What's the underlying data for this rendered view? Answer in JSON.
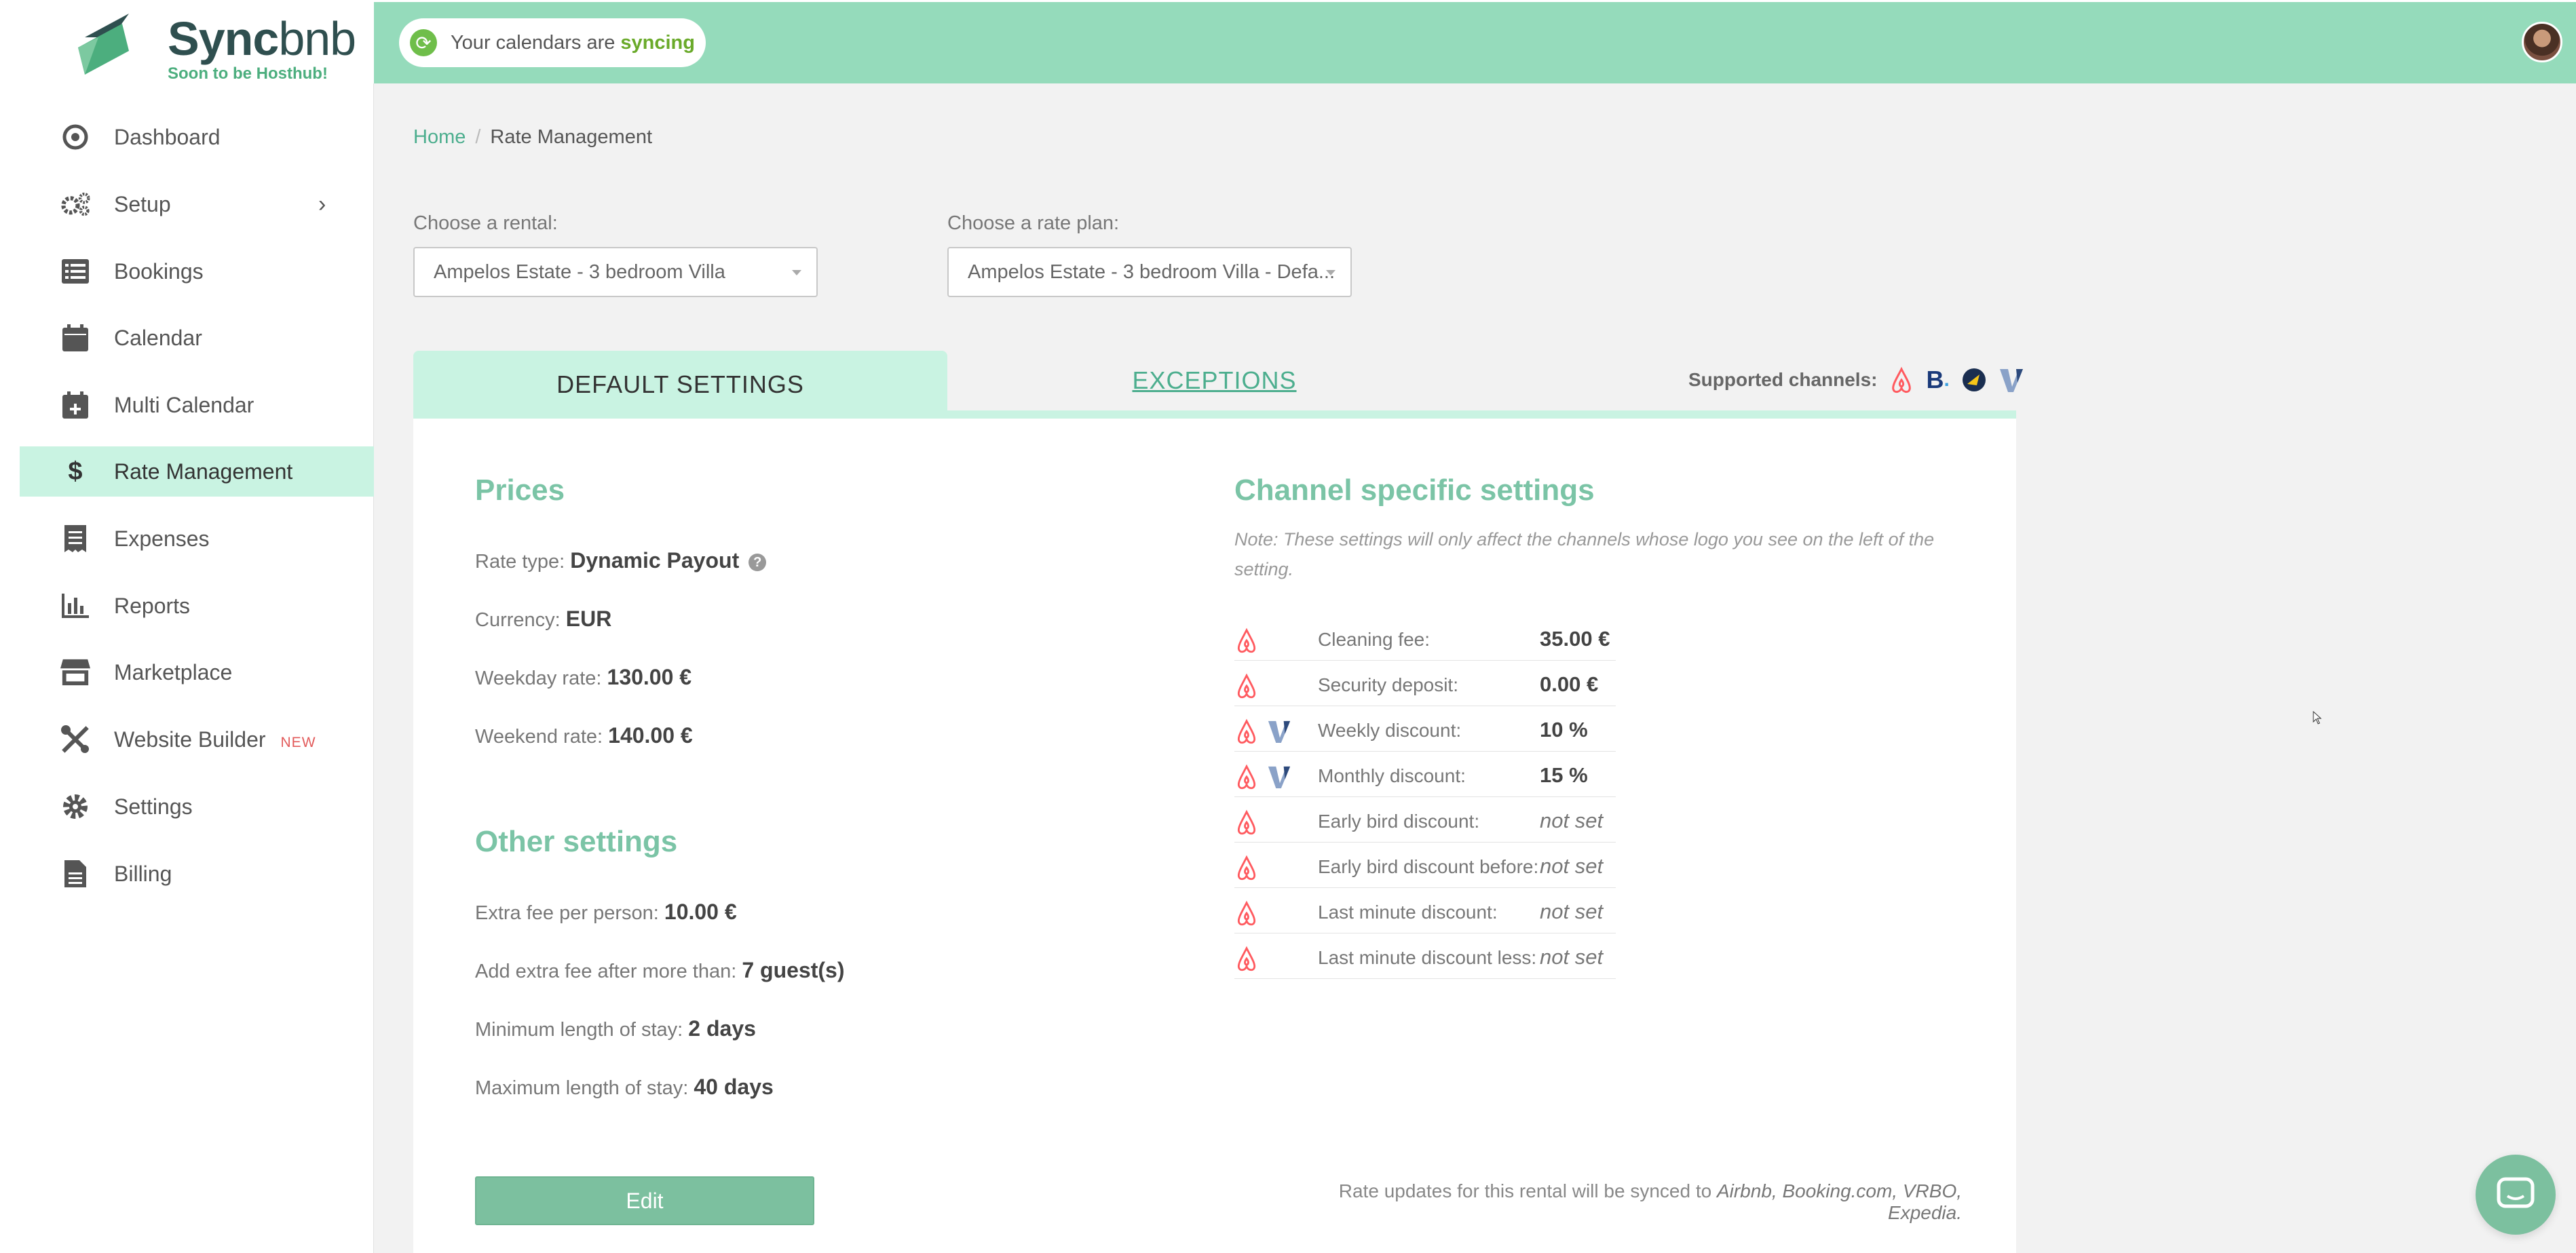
{
  "app": {
    "name_bold": "Sync",
    "name_light": "bnb",
    "subtitle": "Soon to be Hosthub!"
  },
  "sync_status": {
    "prefix": "Your calendars are",
    "state": "syncing"
  },
  "sidebar": {
    "items": [
      {
        "label": "Dashboard",
        "icon": "dashboard-icon"
      },
      {
        "label": "Setup",
        "icon": "gears-icon"
      },
      {
        "label": "Bookings",
        "icon": "list-icon"
      },
      {
        "label": "Calendar",
        "icon": "calendar-icon"
      },
      {
        "label": "Multi Calendar",
        "icon": "calendar-plus-icon"
      },
      {
        "label": "Rate Management",
        "icon": "dollar-icon",
        "active": true
      },
      {
        "label": "Expenses",
        "icon": "receipt-icon"
      },
      {
        "label": "Reports",
        "icon": "bar-chart-icon"
      },
      {
        "label": "Marketplace",
        "icon": "store-icon"
      },
      {
        "label": "Website Builder",
        "icon": "tools-icon",
        "badge": "NEW"
      },
      {
        "label": "Settings",
        "icon": "gear-icon"
      },
      {
        "label": "Billing",
        "icon": "document-icon"
      }
    ]
  },
  "breadcrumb": {
    "home": "Home",
    "current": "Rate Management"
  },
  "filters": {
    "rental_label": "Choose a rental:",
    "rental_value": "Ampelos Estate - 3 bedroom Villa",
    "rateplan_label": "Choose a rate plan:",
    "rateplan_value": "Ampelos Estate - 3 bedroom Villa - Defa..."
  },
  "tabs": {
    "default": "DEFAULT SETTINGS",
    "exceptions": "EXCEPTIONS"
  },
  "supported_channels_label": "Supported channels:",
  "prices": {
    "title": "Prices",
    "rate_type_label": "Rate type:",
    "rate_type": "Dynamic Payout",
    "currency_label": "Currency:",
    "currency": "EUR",
    "weekday_label": "Weekday rate:",
    "weekday": "130.00 €",
    "weekend_label": "Weekend rate:",
    "weekend": "140.00 €"
  },
  "other": {
    "title": "Other settings",
    "extra_fee_label": "Extra fee per person:",
    "extra_fee": "10.00 €",
    "after_label": "Add extra fee after more than:",
    "after": "7 guest(s)",
    "min_stay_label": "Minimum length of stay:",
    "min_stay": "2 days",
    "max_stay_label": "Maximum length of stay:",
    "max_stay": "40 days"
  },
  "channel": {
    "title": "Channel specific settings",
    "note": "Note: These settings will only affect the channels whose logo you see on the left of the setting.",
    "rows": [
      {
        "label": "Cleaning fee:",
        "value": "35.00 €",
        "vrbo": false
      },
      {
        "label": "Security deposit:",
        "value": "0.00 €",
        "vrbo": false
      },
      {
        "label": "Weekly discount:",
        "value": "10 %",
        "vrbo": true
      },
      {
        "label": "Monthly discount:",
        "value": "15 %",
        "vrbo": true
      },
      {
        "label": "Early bird discount:",
        "value": "not set",
        "vrbo": false
      },
      {
        "label": "Early bird discount before:",
        "value": "not set",
        "vrbo": false
      },
      {
        "label": "Last minute discount:",
        "value": "not set",
        "vrbo": false
      },
      {
        "label": "Last minute discount less:",
        "value": "not set",
        "vrbo": false
      }
    ]
  },
  "edit_label": "Edit",
  "sync_note": {
    "prefix": "Rate updates for this rental will be synced to",
    "channels": "Airbnb, Booking.com, VRBO, Expedia."
  },
  "colors": {
    "accent": "#95dbbb",
    "active_bg": "#c9f3e2",
    "title_green": "#7bc4a6",
    "button": "#7cc09f"
  }
}
